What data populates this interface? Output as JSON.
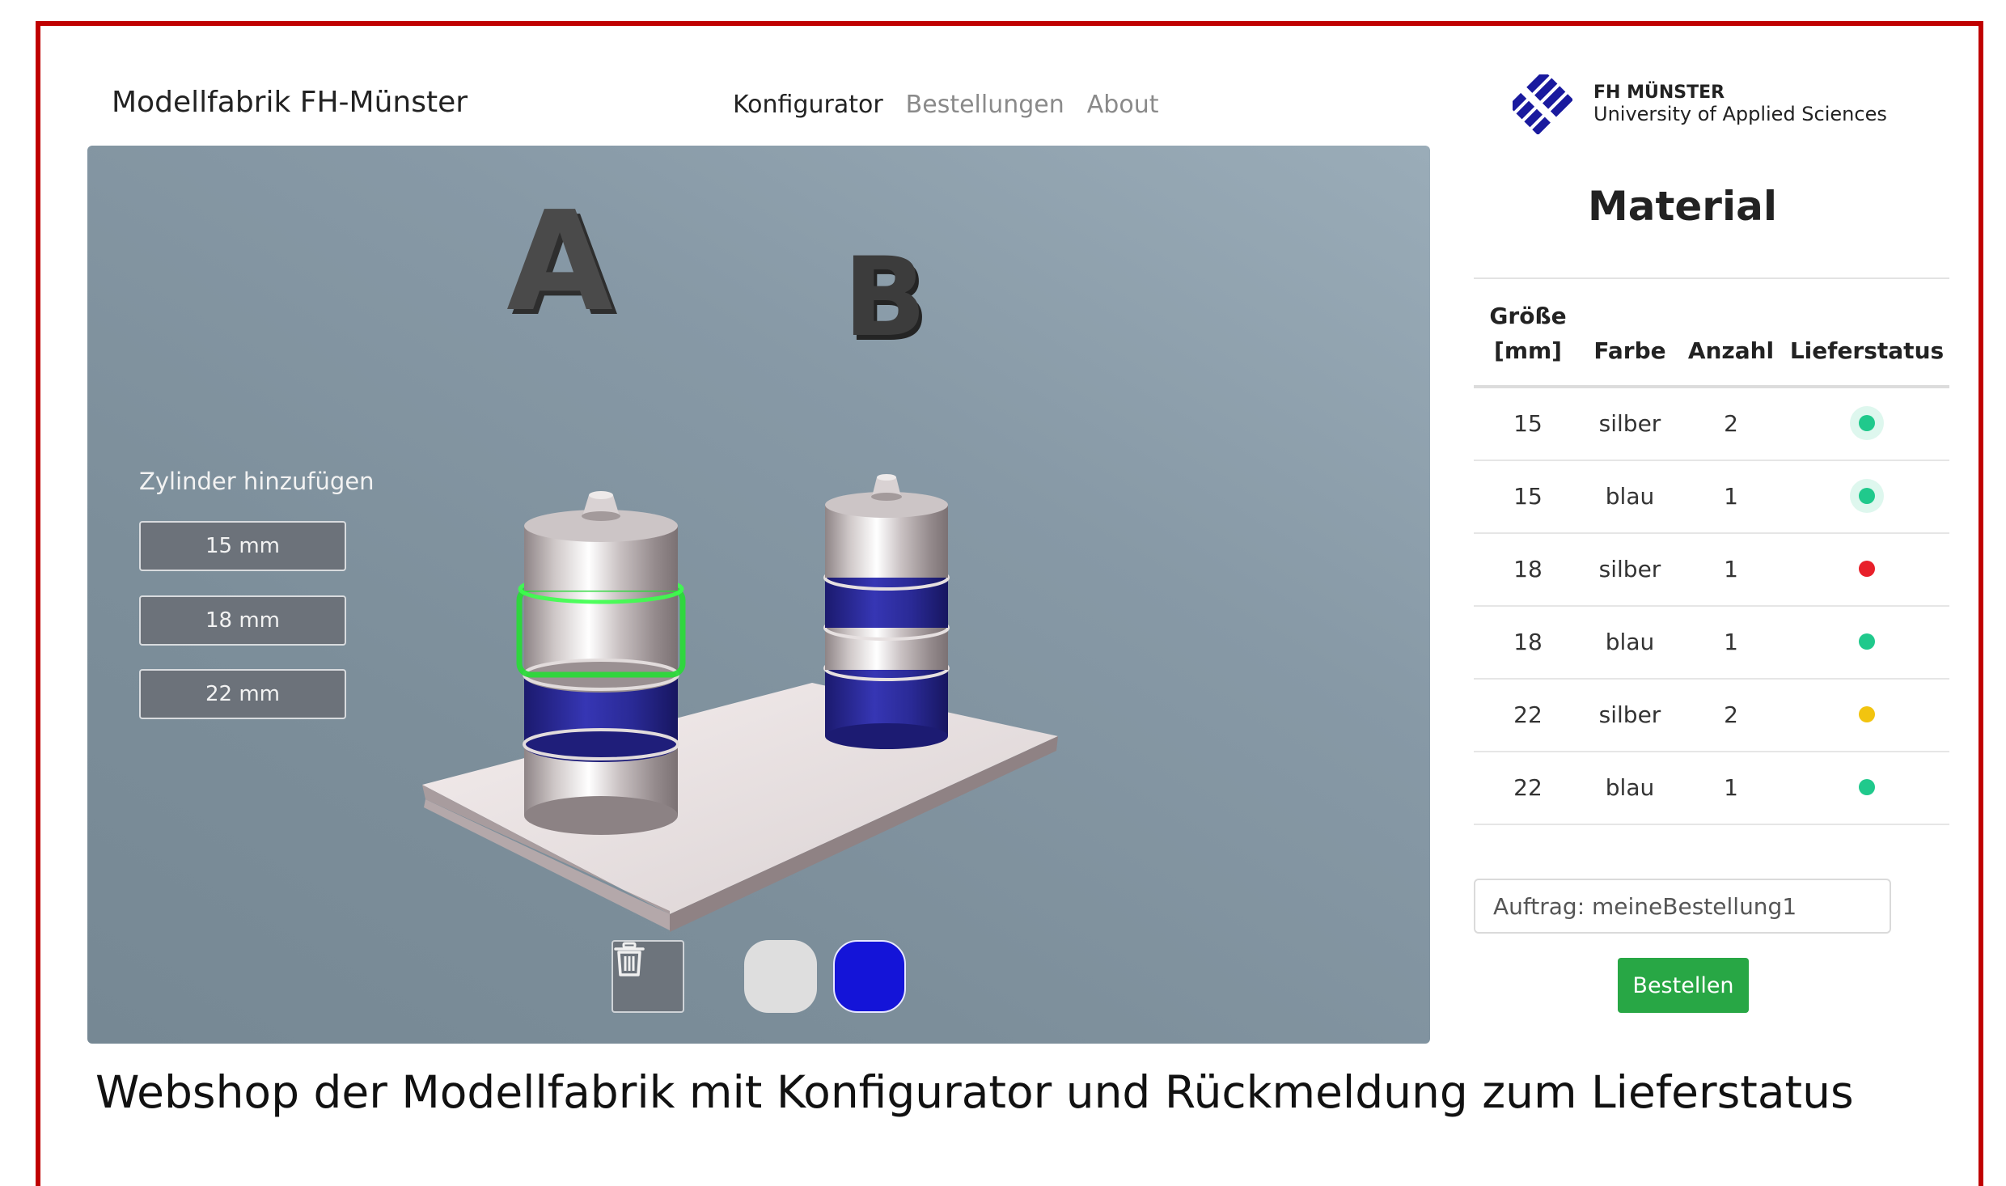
{
  "header": {
    "brand": "Modellfabrik FH-Münster",
    "nav": [
      "Konfigurator",
      "Bestellungen",
      "About"
    ],
    "logo_name": "FH MÜNSTER",
    "logo_subtitle": "University of Applied Sciences"
  },
  "viewer": {
    "label_a": "A",
    "label_b": "B",
    "add_title": "Zylinder hinzufügen",
    "sizes": [
      "15 mm",
      "18 mm",
      "22 mm"
    ],
    "delete_icon": "trash-icon",
    "colors": [
      {
        "name": "silber",
        "hex": "#dedede"
      },
      {
        "name": "blau",
        "hex": "#1414d8"
      }
    ]
  },
  "material": {
    "title": "Material",
    "headers": [
      "Größe [mm]",
      "Farbe",
      "Anzahl",
      "Lieferstatus"
    ],
    "rows": [
      {
        "size": "15",
        "color": "silber",
        "count": "2",
        "status": "green",
        "status_hex": "#20c98c"
      },
      {
        "size": "15",
        "color": "blau",
        "count": "1",
        "status": "green",
        "status_hex": "#20c98c"
      },
      {
        "size": "18",
        "color": "silber",
        "count": "1",
        "status": "red",
        "status_hex": "#e8202a"
      },
      {
        "size": "18",
        "color": "blau",
        "count": "1",
        "status": "green",
        "status_hex": "#20c98c"
      },
      {
        "size": "22",
        "color": "silber",
        "count": "2",
        "status": "yellow",
        "status_hex": "#f2c40f"
      },
      {
        "size": "22",
        "color": "blau",
        "count": "1",
        "status": "green",
        "status_hex": "#20c98c"
      }
    ],
    "order_value": "Auftrag: meineBestellung1",
    "order_button": "Bestellen"
  },
  "caption": "Webshop der Modellfabrik mit Konfigurator und Rückmeldung zum Lieferstatus"
}
